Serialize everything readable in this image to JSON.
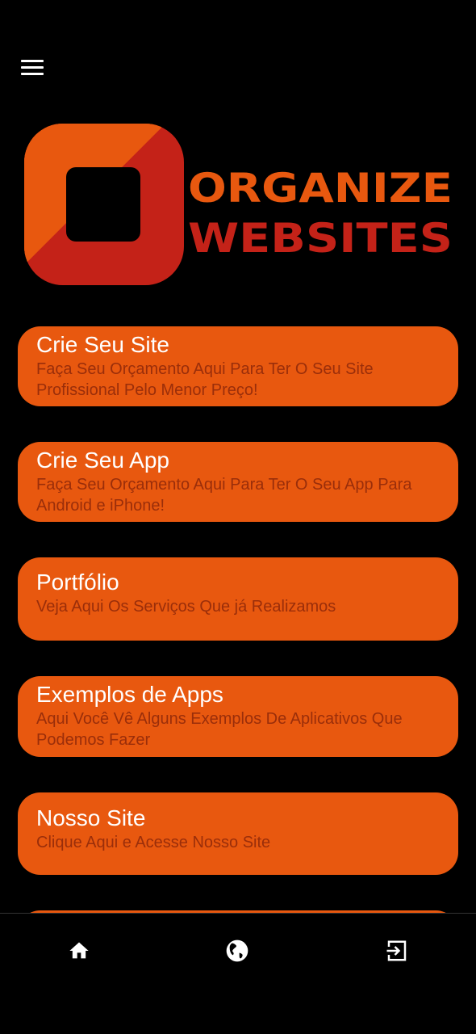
{
  "header": {
    "menu_icon": "hamburger-menu-icon"
  },
  "logo": {
    "line1": "ORGANIZE",
    "line2": "WEBSITES"
  },
  "cards": [
    {
      "title": "Crie Seu Site",
      "subtitle": "Faça Seu Orçamento Aqui Para Ter O Seu Site Profissional Pelo Menor Preço!"
    },
    {
      "title": "Crie Seu App",
      "subtitle": "Faça Seu Orçamento Aqui Para Ter O Seu App Para Android e iPhone!"
    },
    {
      "title": "Portfólio",
      "subtitle": "Veja Aqui Os Serviços Que já Realizamos"
    },
    {
      "title": "Exemplos de Apps",
      "subtitle": "Aqui Você Vê Alguns Exemplos De Aplicativos Que Podemos Fazer"
    },
    {
      "title": "Nosso Site",
      "subtitle": "Clique Aqui e Acesse Nosso Site"
    }
  ],
  "bottom_nav": [
    "home-icon",
    "globe-icon",
    "login-icon"
  ],
  "colors": {
    "card": "#e8580f",
    "subtitle": "#9a2e0a",
    "logo_orange": "#e8580f",
    "logo_red": "#c42218"
  }
}
